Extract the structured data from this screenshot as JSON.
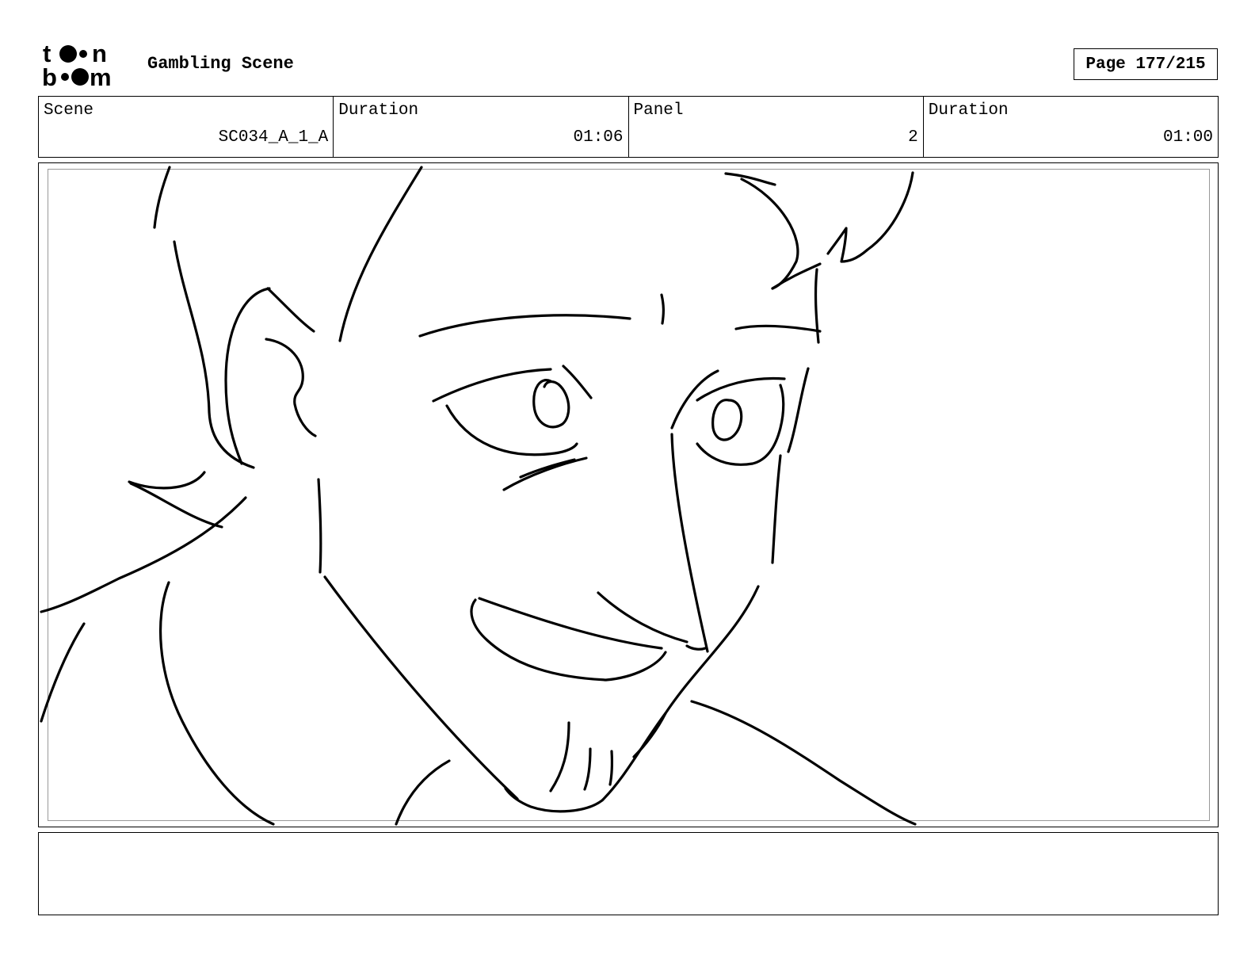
{
  "header": {
    "logo_top": "t",
    "logo_top_end": "n",
    "logo_bottom_start": "b",
    "logo_bottom_end": "m",
    "project_title": "Gambling Scene",
    "page": "Page 177/215"
  },
  "info": {
    "scene_label": "Scene",
    "scene_value": "SC034_A_1_A",
    "scene_duration_label": "Duration",
    "scene_duration_value": "01:06",
    "panel_label": "Panel",
    "panel_value": "2",
    "panel_duration_label": "Duration",
    "panel_duration_value": "01:00"
  },
  "notes": {
    "text": ""
  }
}
